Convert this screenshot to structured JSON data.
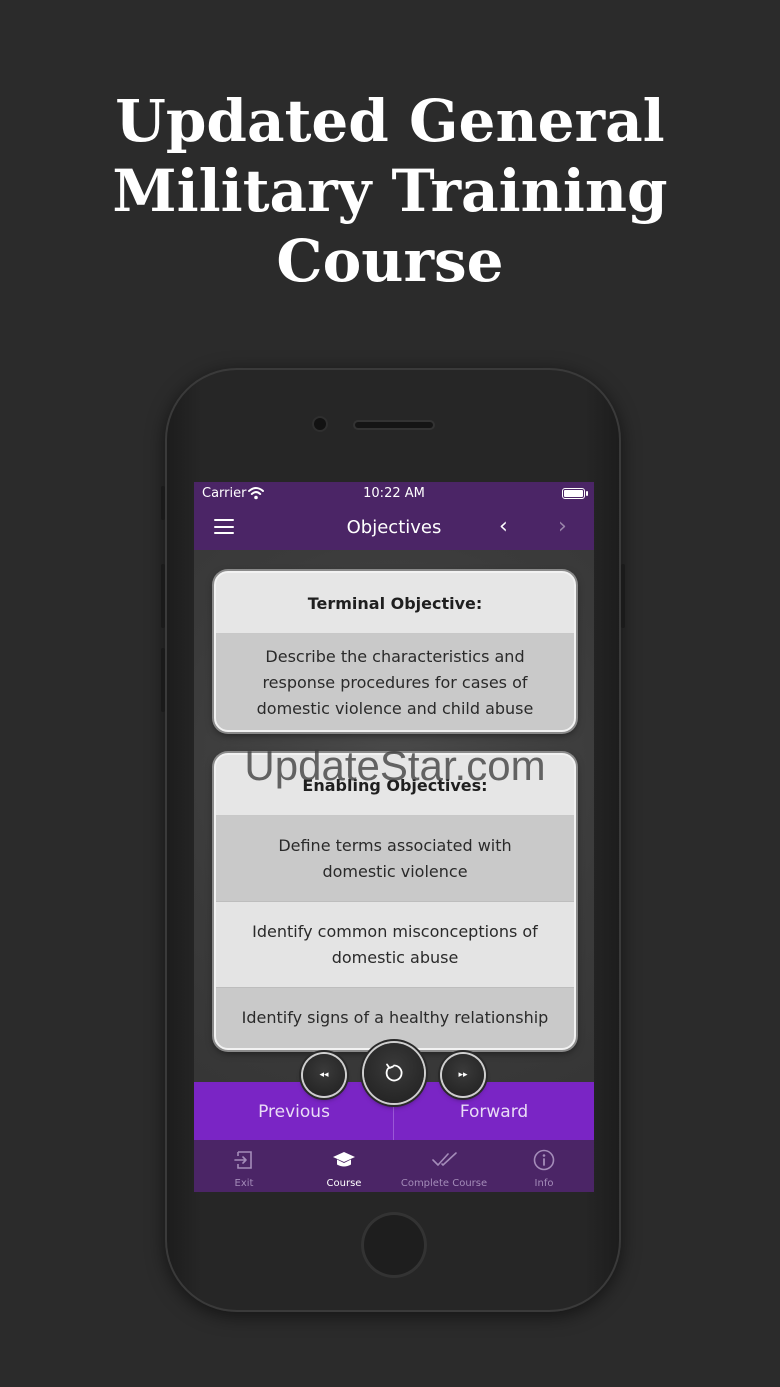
{
  "headline": {
    "line1": "Updated General",
    "line2": "Military Training",
    "line3": "Course"
  },
  "status_bar": {
    "carrier": "Carrier",
    "time": "10:22 AM"
  },
  "nav": {
    "title": "Objectives",
    "back_glyph": "‹",
    "forward_glyph": "›"
  },
  "terminal": {
    "heading": "Terminal Objective:",
    "text": "Describe the characteristics and response procedures for cases of domestic violence and child abuse"
  },
  "enabling": {
    "heading": "Enabling Objectives:",
    "items": [
      "Define terms associated with domestic violence",
      "Identify common misconceptions of domestic abuse",
      "Identify signs of a healthy relationship"
    ]
  },
  "watermark": "UpdateStar.com",
  "controls": {
    "previous_label": "Previous",
    "forward_label": "Forward",
    "rewind_glyph": "◂◂",
    "ffwd_glyph": "▸▸"
  },
  "tabs": [
    {
      "label": "Exit",
      "icon": "exit-icon"
    },
    {
      "label": "Course",
      "icon": "graduation-cap-icon"
    },
    {
      "label": "Complete Course",
      "icon": "double-check-icon"
    },
    {
      "label": "Info",
      "icon": "info-icon"
    }
  ],
  "colors": {
    "nav_purple": "#4b2566",
    "control_purple": "#7a25c5",
    "background": "#2b2b2b"
  }
}
